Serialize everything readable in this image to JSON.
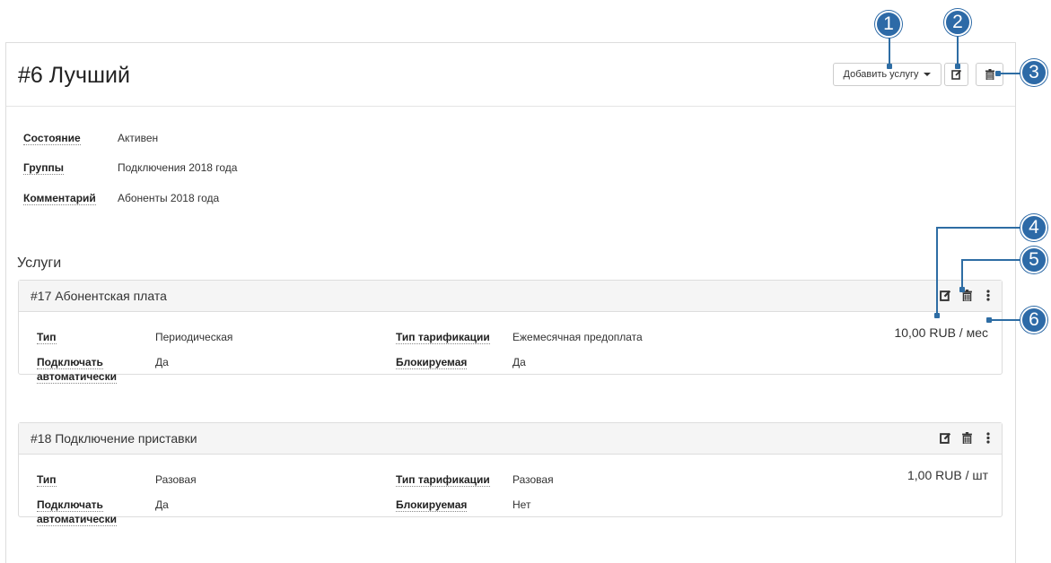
{
  "page": {
    "title": "#6  Лучший",
    "add_service_label": "Добавить услугу"
  },
  "details": [
    {
      "label": "Состояние",
      "value": "Активен"
    },
    {
      "label": "Группы",
      "value": "Подключения 2018 года"
    },
    {
      "label": "Комментарий",
      "value": "Абоненты 2018 года"
    }
  ],
  "services_title": "Услуги",
  "services": [
    {
      "title": "#17  Абонентская плата",
      "type_label": "Тип",
      "type_value": "Периодическая",
      "tariff_label": "Тип тарификации",
      "tariff_value": "Ежемесячная предоплата",
      "auto_label": "Подключать автоматически",
      "auto_value": "Да",
      "block_label": "Блокируемая",
      "block_value": "Да",
      "price": "10,00 RUB / мес"
    },
    {
      "title": "#18  Подключение приставки",
      "type_label": "Тип",
      "type_value": "Разовая",
      "tariff_label": "Тип тарификации",
      "tariff_value": "Разовая",
      "auto_label": "Подключать автоматически",
      "auto_value": "Да",
      "block_label": "Блокируемая",
      "block_value": "Нет",
      "price": "1,00 RUB / шт"
    }
  ],
  "callouts": [
    "1",
    "2",
    "3",
    "4",
    "5",
    "6"
  ],
  "colors": {
    "callout": "#2d6aa7",
    "header_bg": "#f5f5f5",
    "border": "#dddddd"
  },
  "icons": [
    "edit-icon",
    "trash-icon",
    "more-vertical-icon",
    "caret-down-icon"
  ]
}
